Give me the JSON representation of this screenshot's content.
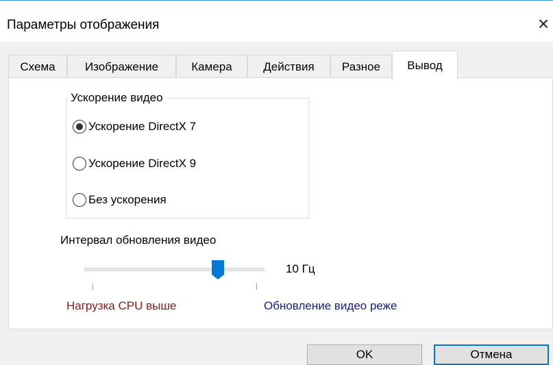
{
  "window": {
    "title": "Параметры отображения",
    "close_glyph": "×"
  },
  "tabs": [
    {
      "label": "Схема",
      "active": false
    },
    {
      "label": "Изображение",
      "active": false
    },
    {
      "label": "Камера",
      "active": false
    },
    {
      "label": "Действия",
      "active": false
    },
    {
      "label": "Разное",
      "active": false
    },
    {
      "label": "Вывод",
      "active": true
    }
  ],
  "video_acceleration": {
    "group_label": "Ускорение видео",
    "options": [
      {
        "label": "Ускорение DirectX 7",
        "selected": true
      },
      {
        "label": "Ускорение DirectX 9",
        "selected": false
      },
      {
        "label": "Без ускорения",
        "selected": false
      }
    ]
  },
  "refresh": {
    "label": "Интервал обновления видео",
    "slider_fraction": 0.74,
    "value_text": "10 Гц",
    "left_hint": "Нагрузка CPU выше",
    "right_hint": "Обновление видео реже"
  },
  "buttons": {
    "ok": "OK",
    "cancel": "Отмена"
  },
  "colors": {
    "accent": "#0078d7",
    "left_hint": "#8b1a1a",
    "right_hint": "#151c86"
  }
}
